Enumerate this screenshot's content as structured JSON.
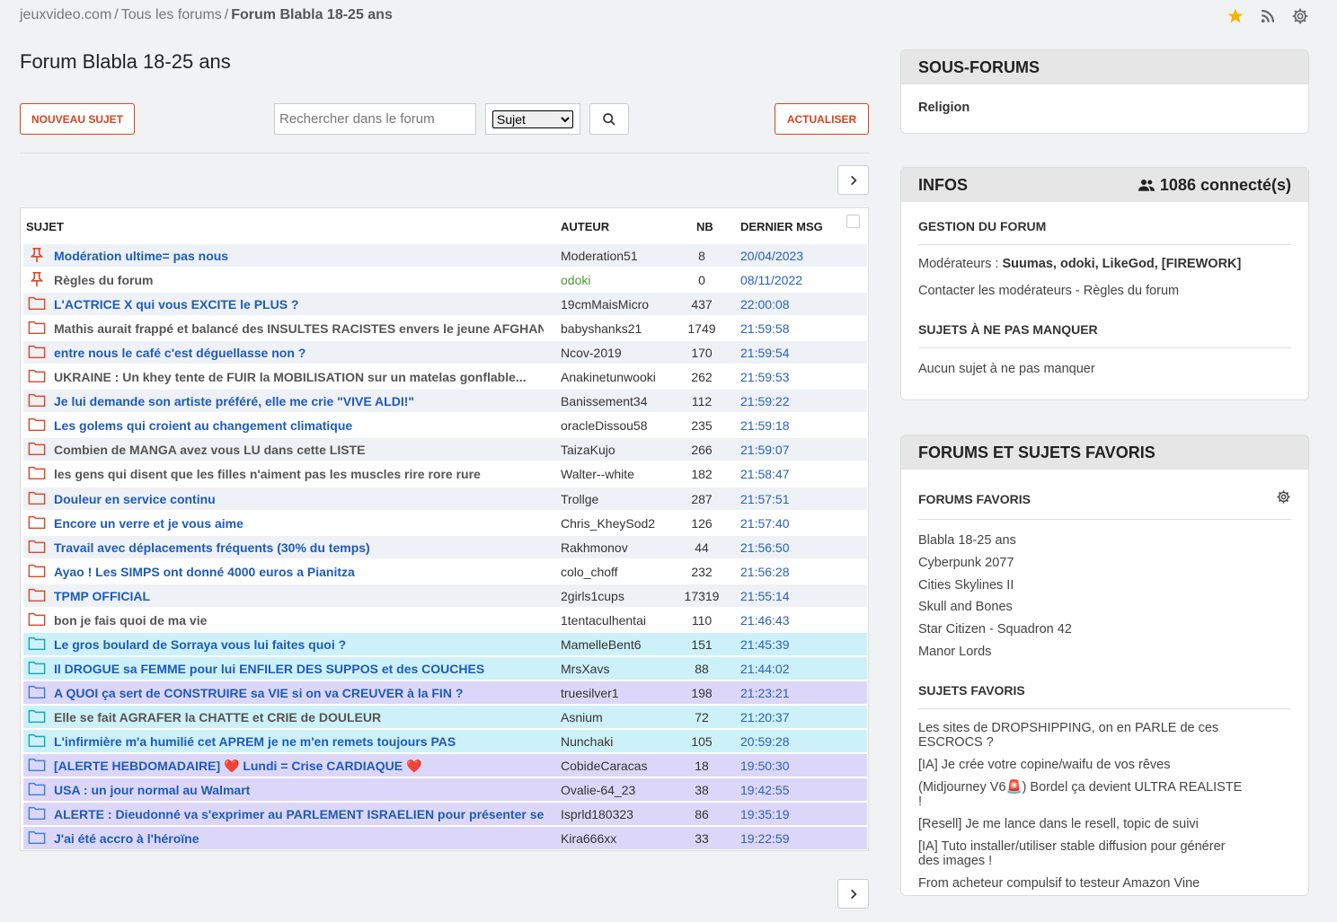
{
  "breadcrumb": {
    "site": "jeuxvideo.com",
    "sep1": "/",
    "all": "Tous les forums",
    "sep2": "/",
    "current": "Forum Blabla 18-25 ans"
  },
  "icons": {
    "favorite": "star-icon",
    "rss": "rss-icon",
    "settings": "gear-icon"
  },
  "colors": {
    "accent": "#d9431e",
    "link_blue": "#1e5bb8",
    "date_blue": "#2a62b5",
    "star": "#f5b400"
  },
  "page_title": "Forum Blabla 18-25 ans",
  "toolbar": {
    "new_topic": "NOUVEAU SUJET",
    "search_placeholder": "Rechercher dans le forum",
    "search_mode": "Sujet",
    "refresh": "ACTUALISER"
  },
  "table": {
    "headers": {
      "subject": "SUJET",
      "author": "AUTEUR",
      "nb": "NB",
      "last": "DERNIER MSG"
    },
    "rows": [
      {
        "icon": "pin-icon",
        "subject": "Modération ultime= pas nous",
        "author": "Moderation51",
        "nb": "8",
        "last": "20/04/2023"
      },
      {
        "icon": "pin-icon",
        "subject": "Règles du forum",
        "author": "odoki",
        "nb": "0",
        "last": "08/11/2022"
      },
      {
        "icon": "folder-red-icon",
        "subject": "L'ACTRICE X qui vous EXCITE le PLUS ?",
        "author": "19cmMaisMicro",
        "nb": "437",
        "last": "22:00:08"
      },
      {
        "icon": "folder-red-icon",
        "subject": "Mathis aurait frappé et balancé des INSULTES RACISTES envers le jeune AFGHAN",
        "author": "babyshanks21",
        "nb": "1749",
        "last": "21:59:58"
      },
      {
        "icon": "folder-red-icon",
        "subject": "entre nous le café c'est déguellasse non ?",
        "author": "Ncov-2019",
        "nb": "170",
        "last": "21:59:54"
      },
      {
        "icon": "folder-red-icon",
        "subject": "UKRAINE : Un khey tente de FUIR la MOBILISATION sur un matelas gonflable...",
        "author": "Anakinetunwooki",
        "nb": "262",
        "last": "21:59:53"
      },
      {
        "icon": "folder-red-icon",
        "subject": "Je lui demande son artiste préféré, elle me crie \"VIVE ALDI!\"",
        "author": "Banissement34",
        "nb": "112",
        "last": "21:59:22"
      },
      {
        "icon": "folder-red-icon",
        "subject": "Les golems qui croient au changement climatique",
        "author": "oracleDissou58",
        "nb": "235",
        "last": "21:59:18"
      },
      {
        "icon": "folder-red-icon",
        "subject": "Combien de MANGA avez vous LU dans cette LISTE",
        "author": "TaizaKujo",
        "nb": "266",
        "last": "21:59:07"
      },
      {
        "icon": "folder-red-icon",
        "subject": "les gens qui disent que les filles n'aiment pas les muscles rire rore rure",
        "author": "Walter--white",
        "nb": "182",
        "last": "21:58:47"
      },
      {
        "icon": "folder-red-icon",
        "subject": "Douleur en service continu",
        "author": "Trollge",
        "nb": "287",
        "last": "21:57:51"
      },
      {
        "icon": "folder-red-icon",
        "subject": "Encore un verre et je vous aime",
        "author": "Chris_KheySod2",
        "nb": "126",
        "last": "21:57:40"
      },
      {
        "icon": "folder-red-icon",
        "subject": "Travail avec déplacements fréquents (30% du temps)",
        "author": "Rakhmonov",
        "nb": "44",
        "last": "21:56:50"
      },
      {
        "icon": "folder-red-icon",
        "subject": "Ayao ! Les SIMPS ont donné 4000 euros a Pianitza",
        "author": "colo_choff",
        "nb": "232",
        "last": "21:56:28"
      },
      {
        "icon": "folder-red-icon",
        "subject": "TPMP OFFICIAL",
        "author": "2girls1cups",
        "nb": "17319",
        "last": "21:55:14"
      },
      {
        "icon": "folder-red-icon",
        "subject": "bon je fais quoi de ma vie",
        "author": "1tentaculhentai",
        "nb": "110",
        "last": "21:46:43"
      },
      {
        "icon": "folder-cyan-icon",
        "subject": "Le gros boulard de Sorraya vous lui faites quoi ?",
        "author": "MamelleBent6",
        "nb": "151",
        "last": "21:45:39"
      },
      {
        "icon": "folder-cyan-icon",
        "subject": "Il DROGUE sa FEMME pour lui ENFILER DES SUPPOS et des COUCHES",
        "author": "MrsXavs",
        "nb": "88",
        "last": "21:44:02"
      },
      {
        "icon": "folder-blue-icon",
        "subject": "A QUOI ça sert de CONSTRUIRE sa VIE si on va CREUVER à la FIN ?",
        "author": "truesilver1",
        "nb": "198",
        "last": "21:23:21"
      },
      {
        "icon": "folder-cyan-icon",
        "subject": "Elle se fait AGRAFER la CHATTE et CRIE de DOULEUR",
        "author": "Asnium",
        "nb": "72",
        "last": "21:20:37"
      },
      {
        "icon": "folder-cyan-icon",
        "subject": "L'infirmière m'a humilié cet APREM je ne m'en remets toujours PAS",
        "author": "Nunchaki",
        "nb": "105",
        "last": "20:59:28"
      },
      {
        "icon": "folder-blue-icon",
        "subject": "[ALERTE HEBDOMADAIRE] ❤️ Lundi = Crise CARDIAQUE ❤️",
        "author": "CobideCaracas",
        "nb": "18",
        "last": "19:50:30"
      },
      {
        "icon": "folder-blue-icon",
        "subject": "USA : un jour normal au Walmart",
        "author": "Ovalie-64_23",
        "nb": "38",
        "last": "19:42:55"
      },
      {
        "icon": "folder-blue-icon",
        "subject": "ALERTE : Dieudonné va s'exprimer au PARLEMENT ISRAELIEN pour présenter ses exc...",
        "author": "Isprld180323",
        "nb": "86",
        "last": "19:35:19"
      },
      {
        "icon": "folder-blue-icon",
        "subject": "J'ai été accro à l'héroïne",
        "author": "Kira666xx",
        "nb": "33",
        "last": "19:22:59"
      }
    ]
  },
  "sidebar": {
    "subforums": {
      "title": "SOUS-FORUMS",
      "items": [
        "Religion"
      ]
    },
    "infos": {
      "title": "INFOS",
      "connected": "1086 connecté(s)",
      "management_title": "GESTION DU FORUM",
      "moderators_label": "Modérateurs : ",
      "moderators": "Suumas, odoki, LikeGod, [FIREWORK]",
      "contact": "Contacter les modérateurs",
      "contact_sep": " - ",
      "rules": "Règles du forum",
      "must_see_title": "SUJETS À NE PAS MANQUER",
      "must_see_empty": "Aucun sujet à ne pas manquer"
    },
    "favorites": {
      "title": "FORUMS ET SUJETS FAVORIS",
      "forums_title": "FORUMS FAVORIS",
      "forums": [
        "Blabla 18-25 ans",
        "Cyberpunk 2077",
        "Cities Skylines II",
        "Skull and Bones",
        "Star Citizen - Squadron 42",
        "Manor Lords"
      ],
      "topics_title": "SUJETS FAVORIS",
      "topics": [
        "Les sites de DROPSHIPPING, on en PARLE de ces ESCROCS ?",
        "[IA] Je crée votre copine/waifu de vos rêves",
        "(Midjourney V6🚨) Bordel ça devient ULTRA REALISTE !",
        "[Resell] Je me lance dans le resell, topic de suivi",
        "[IA] Tuto installer/utiliser stable diffusion pour générer des images !",
        "From acheteur compulsif to testeur Amazon Vine"
      ]
    }
  }
}
